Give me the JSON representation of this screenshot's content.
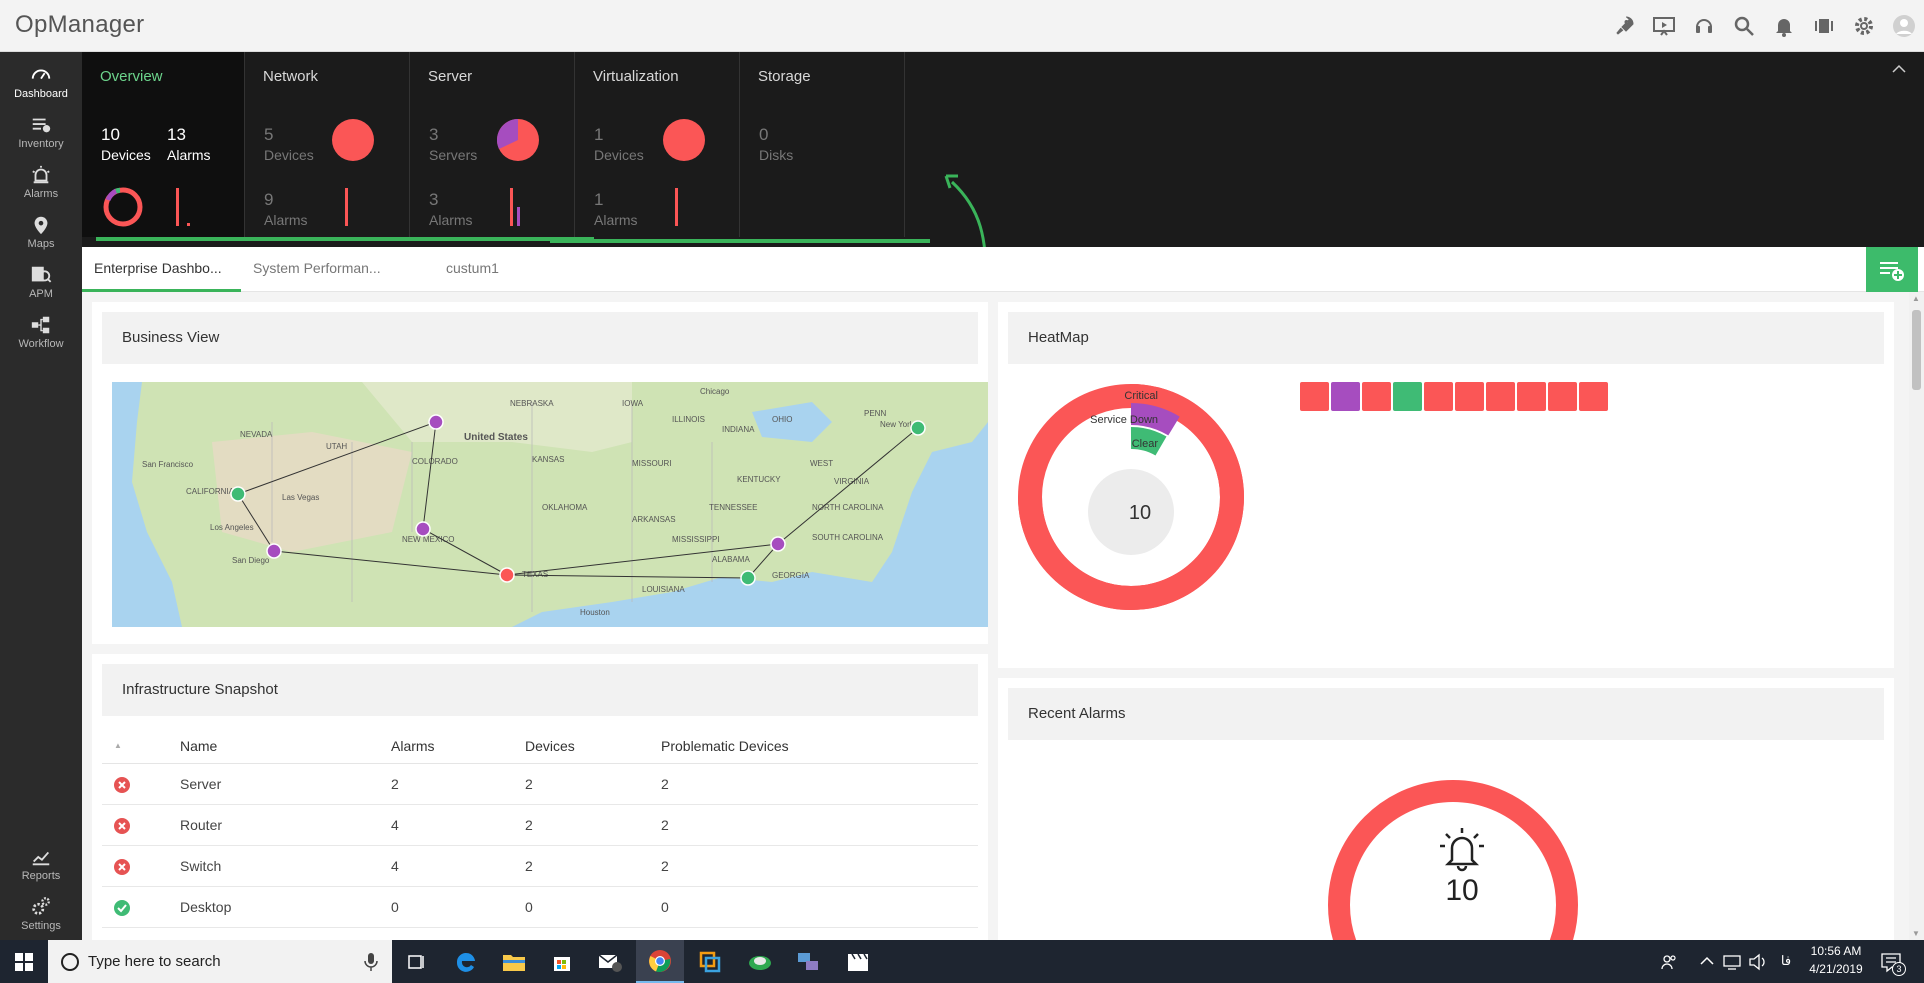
{
  "app": {
    "title": "OpManager"
  },
  "nav": [
    {
      "label": "Dashboard",
      "icon": "speedometer-icon"
    },
    {
      "label": "Inventory",
      "icon": "inventory-icon"
    },
    {
      "label": "Alarms",
      "icon": "alarm-siren-icon"
    },
    {
      "label": "Maps",
      "icon": "map-pin-icon"
    },
    {
      "label": "APM",
      "icon": "apm-icon"
    },
    {
      "label": "Workflow",
      "icon": "workflow-icon"
    },
    {
      "label": "Reports",
      "icon": "reports-chart-icon"
    },
    {
      "label": "Settings",
      "icon": "settings-gears-icon"
    }
  ],
  "summary": {
    "overview": {
      "title": "Overview",
      "devices_num": "10",
      "devices_lbl": "Devices",
      "alarms_num": "13",
      "alarms_lbl": "Alarms"
    },
    "network": {
      "title": "Network",
      "n1": "5",
      "l1": "Devices",
      "n2": "9",
      "l2": "Alarms"
    },
    "server": {
      "title": "Server",
      "n1": "3",
      "l1": "Servers",
      "n2": "3",
      "l2": "Alarms"
    },
    "virtualization": {
      "title": "Virtualization",
      "n1": "1",
      "l1": "Devices",
      "n2": "1",
      "l2": "Alarms"
    },
    "storage": {
      "title": "Storage",
      "n1": "0",
      "l1": "Disks"
    }
  },
  "tabs": [
    "Enterprise Dashbo...",
    "System Performan...",
    "custum1"
  ],
  "business_view": {
    "title": "Business View",
    "labels": {
      "us": "United States",
      "nevada": "NEVADA",
      "utah": "UTAH",
      "colorado": "COLORADO",
      "kansas": "KANSAS",
      "nebraska": "NEBRASKA",
      "iowa": "IOWA",
      "illinois": "ILLINOIS",
      "ohio": "OHIO",
      "penn": "PENN",
      "newyork": "New York",
      "california": "CALIFORNIA",
      "sf": "San Francisco",
      "lasvegas": "Las Vegas",
      "la": "Los Angeles",
      "sd": "San Diego",
      "newmexico": "NEW MEXICO",
      "texas": "TEXAS",
      "oklahoma": "OKLAHOMA",
      "missouri": "MISSOURI",
      "kentucky": "KENTUCKY",
      "tennessee": "TENNESSEE",
      "virginia": "VIRGINIA",
      "westva": "WEST",
      "ncarolina": "NORTH CAROLINA",
      "scarolina": "SOUTH CAROLINA",
      "georgia": "GEORGIA",
      "alabama": "ALABAMA",
      "mississippi": "MISSISSIPPI",
      "louisiana": "LOUISIANA",
      "houston": "Houston",
      "chicago": "Chicago",
      "arkansas": "ARKANSAS",
      "indiana": "INDIANA"
    }
  },
  "heatmap": {
    "title": "HeatMap",
    "legend": [
      "Critical",
      "Service Down",
      "Clear"
    ],
    "center_value": "10",
    "colors": {
      "critical": "#fb5656",
      "service_down": "#a64dbf",
      "clear": "#3fbb75"
    },
    "boxes": [
      "critical",
      "service_down",
      "critical",
      "clear",
      "critical",
      "critical",
      "critical",
      "critical",
      "critical",
      "critical"
    ]
  },
  "infra": {
    "title": "Infrastructure Snapshot",
    "columns": [
      "Name",
      "Alarms",
      "Devices",
      "Problematic Devices"
    ],
    "rows": [
      {
        "status": "error",
        "name": "Server",
        "alarms": "2",
        "devices": "2",
        "problematic": "2"
      },
      {
        "status": "error",
        "name": "Router",
        "alarms": "4",
        "devices": "2",
        "problematic": "2"
      },
      {
        "status": "error",
        "name": "Switch",
        "alarms": "4",
        "devices": "2",
        "problematic": "2"
      },
      {
        "status": "ok",
        "name": "Desktop",
        "alarms": "0",
        "devices": "0",
        "problematic": "0"
      }
    ]
  },
  "recent_alarms": {
    "title": "Recent Alarms",
    "value": "10"
  },
  "taskbar": {
    "search_placeholder": "Type here to search",
    "time": "10:56 AM",
    "date": "4/21/2019",
    "lang": "فا",
    "notifications": "3"
  }
}
